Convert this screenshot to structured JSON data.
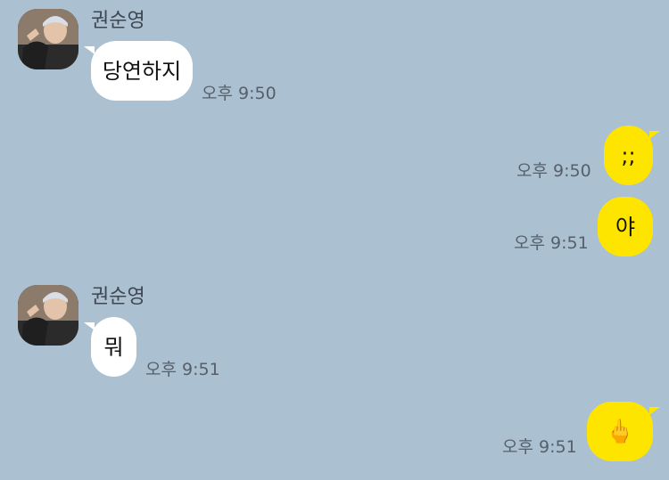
{
  "theme": {
    "background": "#abc1d1",
    "incoming_bubble": "#ffffff",
    "outgoing_bubble": "#fee500"
  },
  "messages": [
    {
      "direction": "incoming",
      "sender": "권순영",
      "text": "당연하지",
      "time": "오후 9:50"
    },
    {
      "direction": "outgoing",
      "text": ";;",
      "time": "오후 9:50"
    },
    {
      "direction": "outgoing",
      "text": "야",
      "time": "오후 9:51"
    },
    {
      "direction": "incoming",
      "sender": "권순영",
      "text": "뭐",
      "time": "오후 9:51"
    },
    {
      "direction": "outgoing",
      "text": "🖕",
      "icon": "middle-finger-emoji",
      "time": "오후 9:51"
    }
  ]
}
